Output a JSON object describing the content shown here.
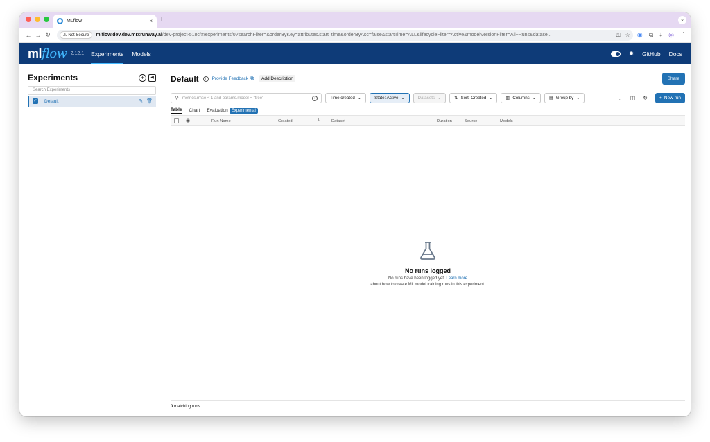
{
  "browser": {
    "tab_title": "MLflow",
    "tab_close": "×",
    "new_tab": "+",
    "not_secure": "Not Secure",
    "url_host": "mlflow.dev.dev.mrxrunway.ai",
    "url_path": "/dev-project-518c/#/experiments/0?searchFilter=&orderByKey=attributes.start_time&orderByAsc=false&startTime=ALL&lifecycleFilter=Active&modelVersionFilter=All+Runs&datase..."
  },
  "header": {
    "logo_ml": "ml",
    "logo_flow": "flow",
    "version": "2.12.1",
    "nav": [
      {
        "label": "Experiments"
      },
      {
        "label": "Models"
      }
    ],
    "github": "GitHub",
    "docs": "Docs"
  },
  "sidebar": {
    "title": "Experiments",
    "search_placeholder": "Search Experiments",
    "items": [
      {
        "label": "Default"
      }
    ]
  },
  "main": {
    "title": "Default",
    "feedback": "Provide Feedback",
    "add_description": "Add Description",
    "share": "Share",
    "search_placeholder": "metrics.rmse < 1 and params.model = \"tree\"",
    "filters": {
      "time_created": "Time created",
      "state": "State: Active",
      "datasets": "Datasets",
      "sort": "Sort: Created",
      "columns": "Columns",
      "group_by": "Group by"
    },
    "new_run": "New run",
    "tabs": {
      "table": "Table",
      "chart": "Chart",
      "evaluation": "Evaluation",
      "experimental": "Experimental"
    },
    "columns": {
      "run_name": "Run Name",
      "created": "Created",
      "dataset": "Dataset",
      "duration": "Duration",
      "source": "Source",
      "models": "Models"
    },
    "empty": {
      "title": "No runs logged",
      "desc_before": "No runs have been logged yet.",
      "link": "Learn more",
      "desc_after": "about how to create ML model training runs in this experiment."
    },
    "footer": {
      "count": "0",
      "label": "matching runs"
    }
  },
  "colors": {
    "header_bg": "#0e3b78",
    "accent": "#2272b4",
    "tabstrip": "#e6d9f2"
  }
}
